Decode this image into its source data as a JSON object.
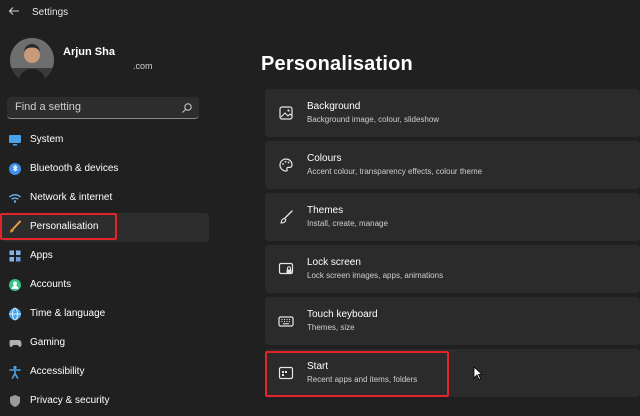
{
  "window": {
    "title": "Settings"
  },
  "profile": {
    "name": "Arjun Sha",
    "email": ".com"
  },
  "search": {
    "placeholder": "Find a setting"
  },
  "sidebar": {
    "items": [
      {
        "label": "System",
        "icon": "monitor-icon",
        "color": "#4aa3e8"
      },
      {
        "label": "Bluetooth & devices",
        "icon": "bluetooth-icon",
        "color": "#3d8ee8"
      },
      {
        "label": "Network & internet",
        "icon": "wifi-icon",
        "color": "#6bb6f0"
      },
      {
        "label": "Personalisation",
        "icon": "brush-icon",
        "color": "#e8a04a"
      },
      {
        "label": "Apps",
        "icon": "apps-icon",
        "color": "#8ab4e6"
      },
      {
        "label": "Accounts",
        "icon": "person-icon",
        "color": "#34c28a"
      },
      {
        "label": "Time & language",
        "icon": "globe-clock-icon",
        "color": "#4aa3e8"
      },
      {
        "label": "Gaming",
        "icon": "gamepad-icon",
        "color": "#b0b0b0"
      },
      {
        "label": "Accessibility",
        "icon": "accessibility-icon",
        "color": "#4aa3e8"
      },
      {
        "label": "Privacy & security",
        "icon": "shield-icon",
        "color": "#9a9a9a"
      }
    ]
  },
  "main": {
    "title": "Personalisation",
    "cards": [
      {
        "title": "Background",
        "desc": "Background image, colour, slideshow",
        "icon": "image-icon"
      },
      {
        "title": "Colours",
        "desc": "Accent colour, transparency effects, colour theme",
        "icon": "palette-icon"
      },
      {
        "title": "Themes",
        "desc": "Install, create, manage",
        "icon": "brush-icon"
      },
      {
        "title": "Lock screen",
        "desc": "Lock screen images, apps, animations",
        "icon": "lock-screen-icon"
      },
      {
        "title": "Touch keyboard",
        "desc": "Themes, size",
        "icon": "keyboard-icon"
      },
      {
        "title": "Start",
        "desc": "Recent apps and items, folders",
        "icon": "start-menu-icon"
      }
    ]
  },
  "colors": {
    "background": "#202020",
    "card": "#2b2b2b",
    "highlight": "#e3242b"
  }
}
